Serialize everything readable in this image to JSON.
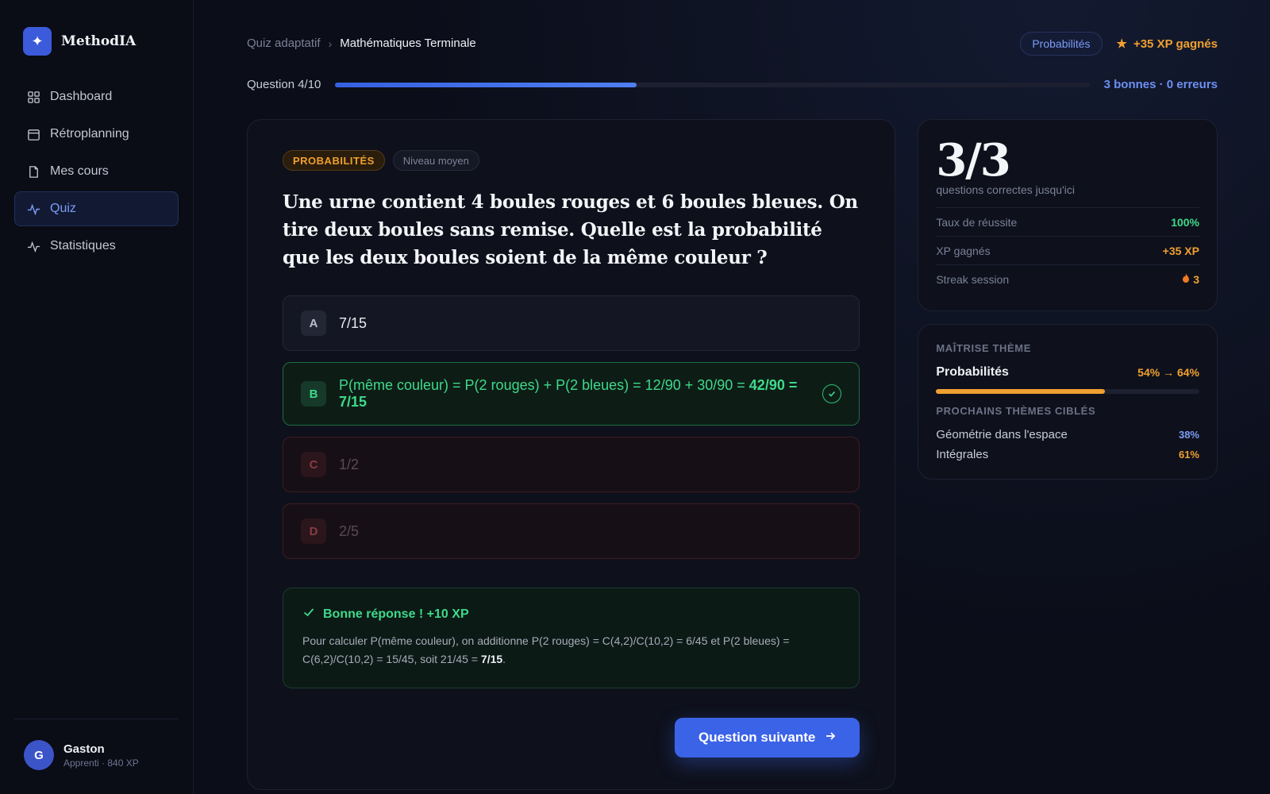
{
  "brand": {
    "logo_glyph": "✦",
    "name": "MethodIA"
  },
  "nav": [
    {
      "label": "Dashboard",
      "icon": "grid-icon",
      "active": false
    },
    {
      "label": "Rétroplanning",
      "icon": "calendar-icon",
      "active": false
    },
    {
      "label": "Mes cours",
      "icon": "document-icon",
      "active": false
    },
    {
      "label": "Quiz",
      "icon": "pulse-icon",
      "active": true
    },
    {
      "label": "Statistiques",
      "icon": "activity-icon",
      "active": false
    }
  ],
  "user": {
    "initial": "G",
    "name": "Gaston",
    "subtitle": "Apprenti · 840 XP"
  },
  "breadcrumb": {
    "parent": "Quiz adaptatif",
    "current": "Mathématiques Terminale"
  },
  "header": {
    "topic_chip": "Probabilités",
    "xp_earned": "+35 XP gagnés"
  },
  "progress": {
    "label": "Question 4/10",
    "fraction": 0.4,
    "summary": "3 bonnes · 0 erreurs"
  },
  "question": {
    "topic_tag": "PROBABILITÉS",
    "level_tag": "Niveau moyen",
    "text": "Une urne contient 4 boules rouges et 6 boules bleues. On tire deux boules sans remise. Quelle est la probabilité que les deux boules soient de la même couleur ?",
    "options": [
      {
        "letter": "A",
        "text": "7/15",
        "state": "neutral"
      },
      {
        "letter": "B",
        "text": "P(même couleur) = P(2 rouges) + P(2 bleues) = 12/90 + 30/90 = ",
        "text_bold": "42/90 = 7/15",
        "state": "correct"
      },
      {
        "letter": "C",
        "text": "1/2",
        "state": "wrong"
      },
      {
        "letter": "D",
        "text": "2/5",
        "state": "wrong"
      }
    ]
  },
  "feedback": {
    "title": "Bonne réponse ! +10 XP",
    "text": "Pour calculer P(même couleur), on additionne P(2 rouges) = C(4,2)/C(10,2) = 6/45 et P(2 bleues) = C(6,2)/C(10,2) = 15/45, soit 21/45 = ",
    "text_bold": "7/15",
    "text_end": "."
  },
  "next_button": "Question suivante",
  "score_panel": {
    "score": "3/3",
    "caption": "questions correctes jusqu'ici",
    "stats": [
      {
        "label": "Taux de réussite",
        "value": "100%",
        "color": "#3fd98a"
      },
      {
        "label": "XP gagnés",
        "value": "+35 XP",
        "color": "#f0a030"
      },
      {
        "label": "Streak session",
        "value": "3",
        "color": "#f0a030"
      }
    ]
  },
  "mastery_panel": {
    "title": "MAÎTRISE THÈME",
    "theme": "Probabilités",
    "value": "54% → 64%",
    "fraction": 0.64,
    "next_title": "PROCHAINS THÈMES CIBLÉS",
    "next_themes": [
      {
        "name": "Géométrie dans l'espace",
        "value": "38%",
        "color": "#7d9cf7"
      },
      {
        "name": "Intégrales",
        "value": "61%",
        "color": "#f0a030"
      }
    ]
  }
}
